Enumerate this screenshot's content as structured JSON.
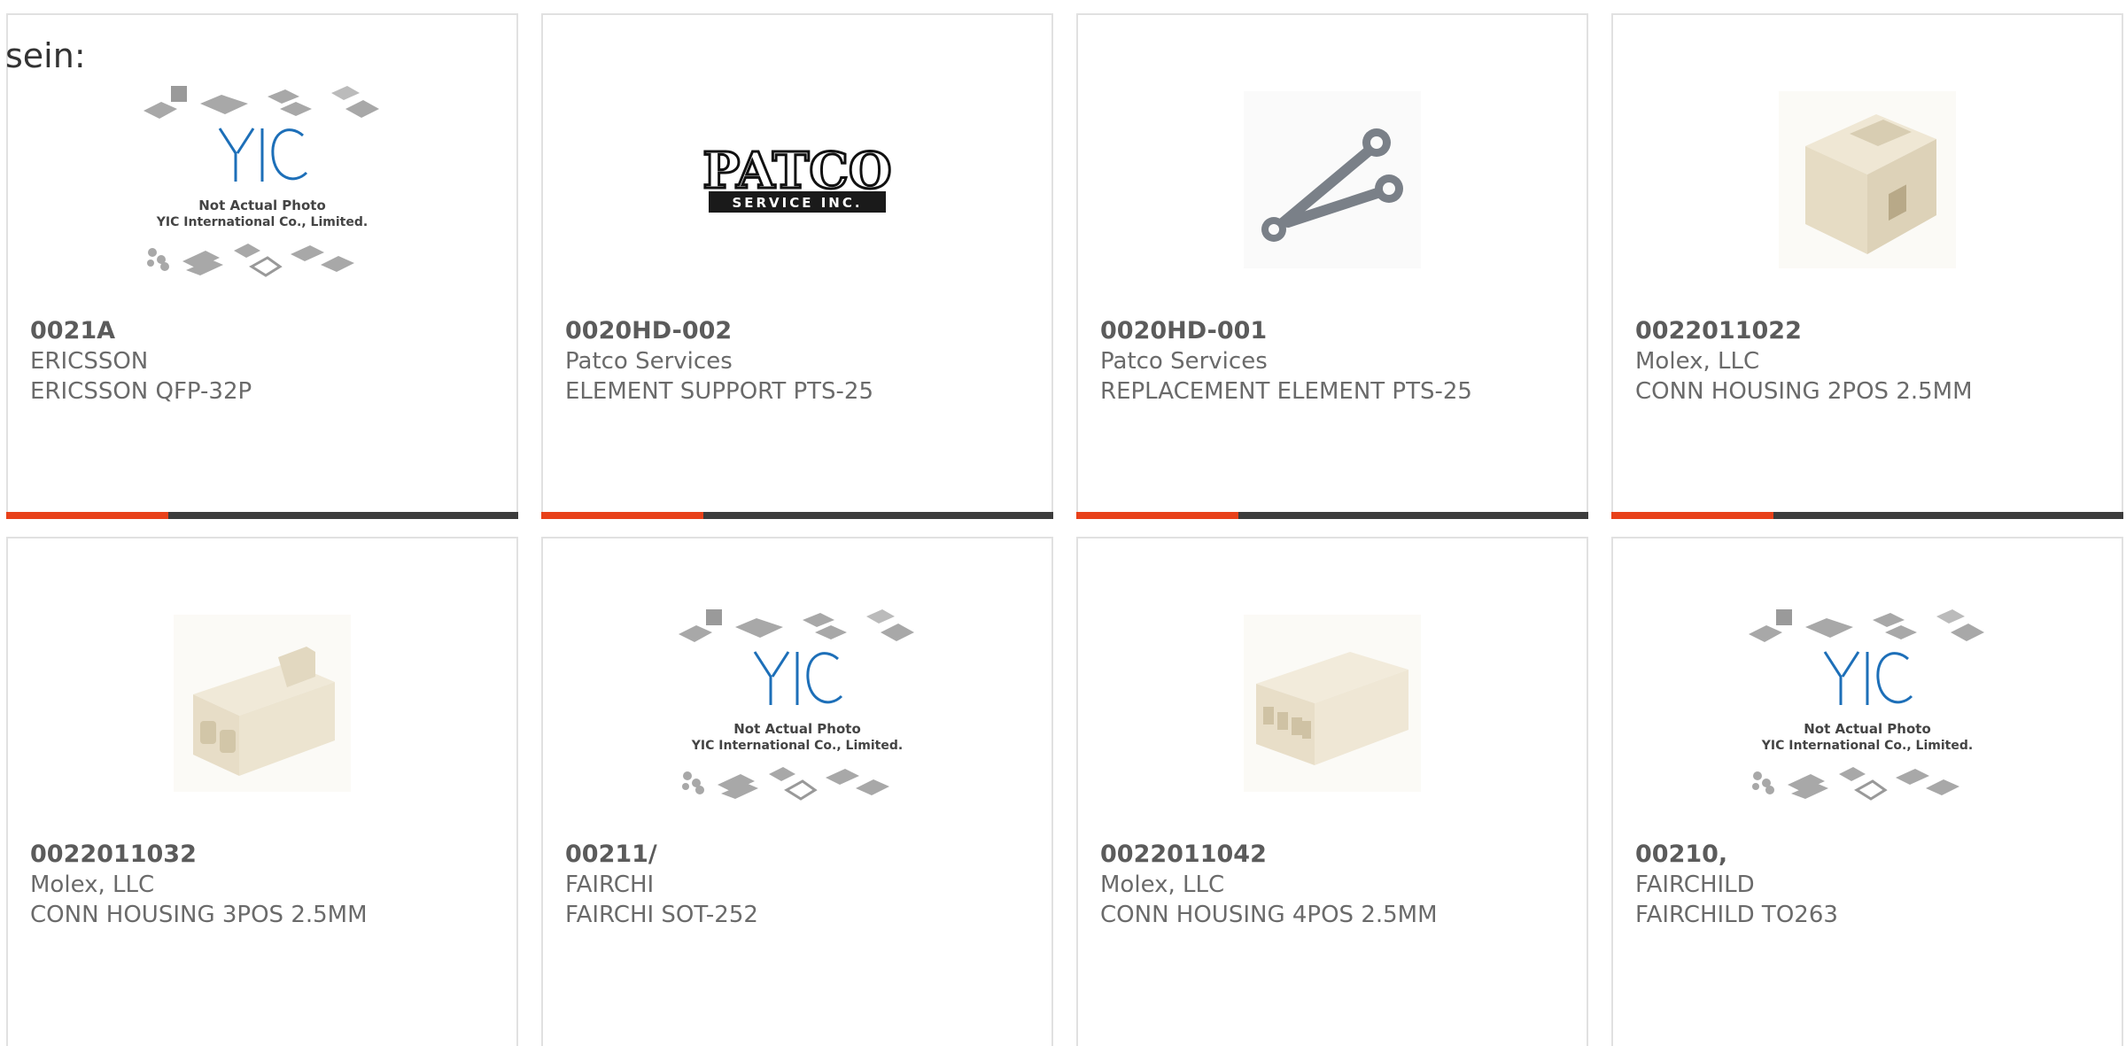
{
  "page_label": "sein:",
  "placeholder_caption": [
    "Not Actual Photo",
    "YIC International Co., Limited."
  ],
  "patco_logo": {
    "top": "PATCO",
    "bottom": "SERVICE INC."
  },
  "products": [
    {
      "part_number": "0021A",
      "manufacturer": "ERICSSON",
      "description": "ERICSSON QFP-32P",
      "image": "placeholder-yic"
    },
    {
      "part_number": "0020HD-002",
      "manufacturer": "Patco Services",
      "description": "ELEMENT SUPPORT PTS-25",
      "image": "patco-logo"
    },
    {
      "part_number": "0020HD-001",
      "manufacturer": "Patco Services",
      "description": "REPLACEMENT ELEMENT PTS-25",
      "image": "element-photo"
    },
    {
      "part_number": "0022011022",
      "manufacturer": "Molex, LLC",
      "description": "CONN HOUSING 2POS 2.5MM",
      "image": "connector-2pos"
    },
    {
      "part_number": "0022011032",
      "manufacturer": "Molex, LLC",
      "description": "CONN HOUSING 3POS 2.5MM",
      "image": "connector-3pos"
    },
    {
      "part_number": "00211/",
      "manufacturer": "FAIRCHI",
      "description": "FAIRCHI SOT-252",
      "image": "placeholder-yic"
    },
    {
      "part_number": "0022011042",
      "manufacturer": "Molex, LLC",
      "description": "CONN HOUSING 4POS 2.5MM",
      "image": "connector-4pos"
    },
    {
      "part_number": "00210,",
      "manufacturer": "FAIRCHILD",
      "description": "FAIRCHILD TO263",
      "image": "placeholder-yic"
    }
  ],
  "colors": {
    "accent": "#e8411a",
    "bar": "#3c3c3c",
    "border": "#e1e1e1",
    "text": "#666666",
    "yic_blue": "#1d6fb8"
  }
}
